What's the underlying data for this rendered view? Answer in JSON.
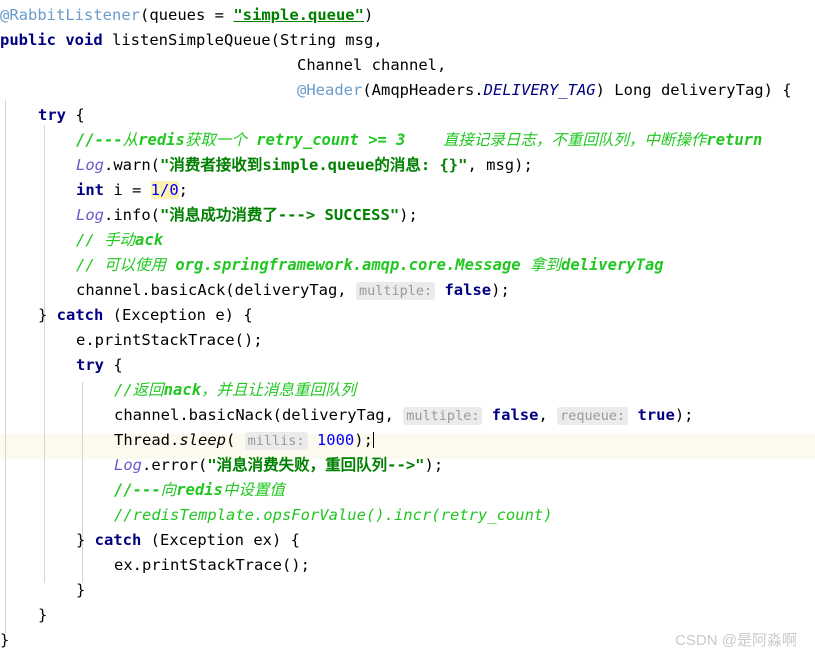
{
  "editor": {
    "language": "java",
    "theme": "intellij-light",
    "background": "#ffffff",
    "caret_line_color": "#fcfaef",
    "indent_guide_color": "#d6d6d6",
    "colors": {
      "keyword": "#000080",
      "string": "#008000",
      "comment": "#22c722",
      "number": "#0000ff",
      "annotation": "#6a9ccc",
      "static_field": "#6a5acd",
      "hint_background": "#ebebeb",
      "hint_text": "#9a9a9a",
      "error_highlight": "#fdf2b2"
    },
    "caret_line_index": 17
  },
  "code": {
    "line01": {
      "annotation": "@RabbitListener",
      "open_paren": "(",
      "param": "queues = ",
      "string": "\"simple.queue\"",
      "close_paren": ")"
    },
    "line02": {
      "modifier": "public",
      "returntype": "void",
      "name": " listenSimpleQueue(",
      "arg": "String msg,"
    },
    "line03": {
      "text": "Channel channel,"
    },
    "line04": {
      "annotation": "@Header",
      "open": "(AmqpHeaders.",
      "constant": "DELIVERY_TAG",
      "rest": ") Long deliveryTag) {"
    },
    "line05": {
      "keyword": "try",
      "brace": " {"
    },
    "line06": {
      "comment_a": "//---",
      "comment_b": "从",
      "comment_c": "redis",
      "comment_d": "获取一个",
      "comment_e": " retry_count >= 3",
      "comment_f": "    直接记录日志，不重回队列，中断操作",
      "comment_g": "return"
    },
    "line07": {
      "field": "Log",
      "call": ".warn(",
      "string": "\"消费者接收到simple.queue的消息: {}\"",
      "args": ", msg);"
    },
    "line08": {
      "keyword": "int",
      "var": " i = ",
      "expr": "1/0",
      "semi": ";"
    },
    "line09": {
      "field": "Log",
      "call": ".info(",
      "string": "\"消息成功消费了---> SUCCESS\"",
      "close": ");"
    },
    "line10": {
      "comment": "// 手动",
      "comment_bold": "ack"
    },
    "line11": {
      "comment_a": "// ",
      "comment_b": "可以使用",
      "comment_c": " org.springframework.amqp.core.Message ",
      "comment_d": "拿到",
      "comment_e": "deliveryTag"
    },
    "line12": {
      "call": "channel.basicAck(deliveryTag, ",
      "hint": "multiple:",
      "value": "false",
      "close": ");"
    },
    "line13": {
      "brace": "} ",
      "keyword": "catch",
      "rest": " (Exception e) {"
    },
    "line14": {
      "text": "e.printStackTrace();"
    },
    "line15": {
      "keyword": "try",
      "brace": " {"
    },
    "line16": {
      "comment_a": "//返回",
      "comment_b": "nack",
      "comment_c": "，并且让消息重回队列"
    },
    "line17": {
      "call": "channel.basicNack(deliveryTag, ",
      "hint1": "multiple:",
      "value1": "false",
      "sep": ", ",
      "hint2": "requeue:",
      "value2": "true",
      "close": ");"
    },
    "line18": {
      "class": "Thread.",
      "method": "sleep",
      "open": "( ",
      "hint": "millis:",
      "value": "1000",
      "close": ");"
    },
    "line19": {
      "field": "Log",
      "call": ".error(",
      "string": "\"消息消费失败，重回队列-->\"",
      "close": ");"
    },
    "line20": {
      "comment_a": "//---",
      "comment_b": "向",
      "comment_c": "redis",
      "comment_d": "中设置值"
    },
    "line21": {
      "comment": "//redisTemplate.opsForValue().incr(retry_count)"
    },
    "line22": {
      "brace": "} ",
      "keyword": "catch",
      "rest": " (Exception ex) {"
    },
    "line23": {
      "text": "ex.printStackTrace();"
    },
    "line24": {
      "text": "}"
    },
    "line25": {
      "text": "}"
    },
    "line26": {
      "text": "}"
    }
  },
  "watermark": {
    "text": "CSDN @是阿淼啊"
  }
}
